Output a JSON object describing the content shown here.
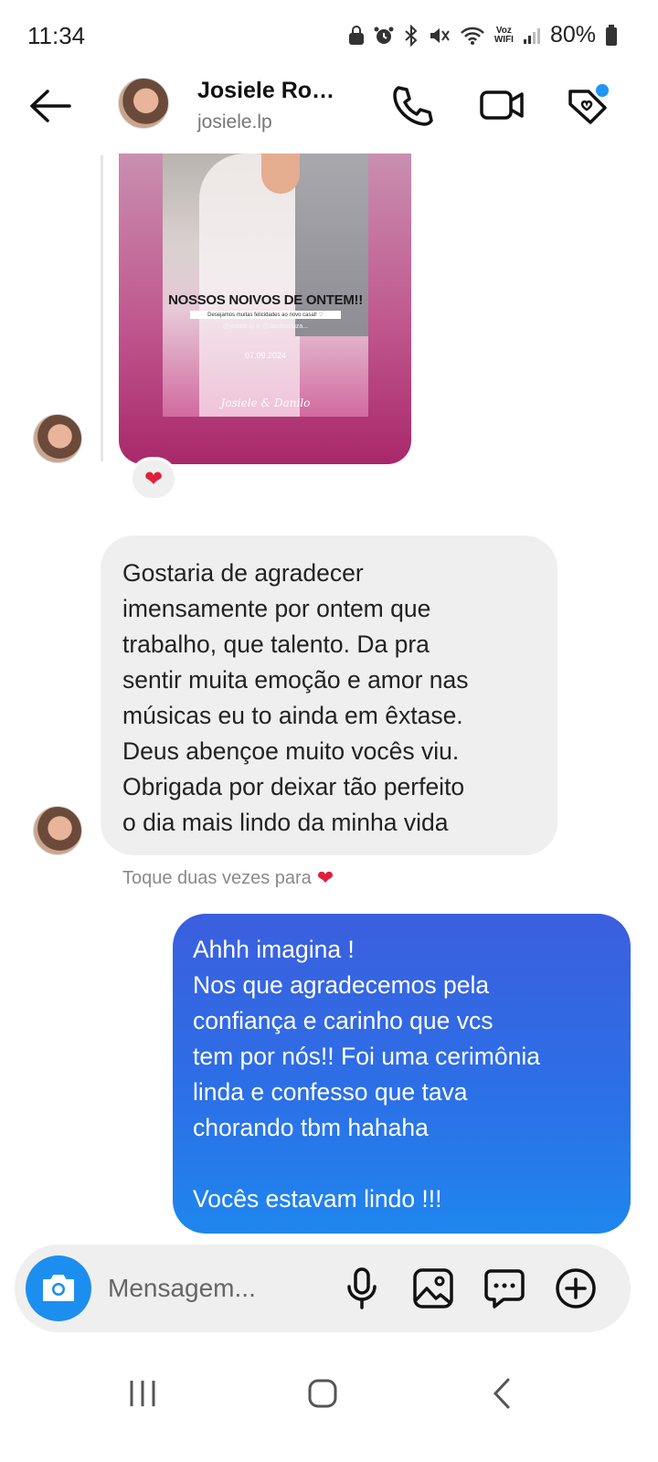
{
  "status_bar": {
    "time": "11:34",
    "voz_label_1": "Voz",
    "voz_label_2": "WIFI",
    "battery": "80%"
  },
  "header": {
    "contact_name": "Josiele Ro…",
    "username": "josiele.lp"
  },
  "shared_post": {
    "title": "NOSSOS NOIVOS DE ONTEM!!",
    "subtitle": "Desejamos muitas felicidades ao novo casal! ♡",
    "handles": "@josiele.lp & @danilosouza...",
    "date": "07.09.2024",
    "signature": "Josiele & Danilo"
  },
  "reaction": "❤",
  "messages": {
    "incoming": "Gostaria de agradecer\nimensamente por ontem que\ntrabalho, que talento. Da pra\nsentir muita emoção e amor nas\nmúsicas eu to ainda em êxtase.\nDeus abençoe muito vocês viu.\nObrigada por deixar tão perfeito\no dia mais lindo da minha vida",
    "hint": "Toque duas vezes para",
    "hint_heart": "❤",
    "outgoing": "Ahhh imagina !\nNos que agradecemos pela\nconfiança e carinho que vcs\ntem por nós!! Foi uma cerimônia\nlinda e confesso que tava\nchorando tbm hahaha\n\nVocês estavam lindo !!!"
  },
  "composer": {
    "placeholder": "Mensagem..."
  },
  "colors": {
    "accent_blue": "#1c8ef0",
    "outgoing_bubble": "#2c6fe6",
    "incoming_bubble": "#efefef",
    "heart": "#e0203a"
  }
}
